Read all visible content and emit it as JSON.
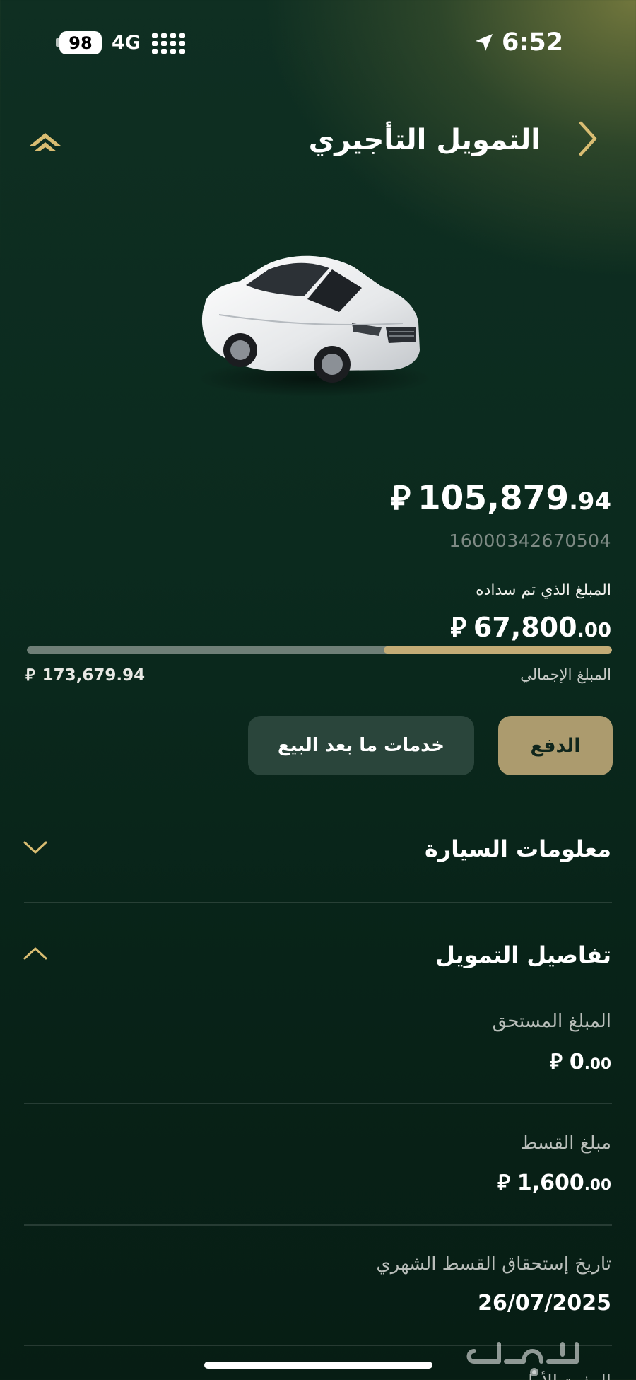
{
  "status_bar": {
    "battery": "98",
    "network": "4G",
    "time": "6:52"
  },
  "header": {
    "title": "التمويل التأجيري"
  },
  "summary": {
    "balance_int": "105,879",
    "balance_dec": ".94",
    "contract_number": "16000342670504",
    "paid_label": "المبلغ الذي تم سداده",
    "paid_int": "67,800",
    "paid_dec": ".00",
    "total_label": "المبلغ الإجمالي",
    "total_amount": "173,679.94",
    "paid_fraction": 0.39
  },
  "actions": {
    "pay_label": "الدفع",
    "aftersales_label": "خدمات ما بعد البيع"
  },
  "sections": {
    "car_info_title": "معلومات السيارة",
    "financing_title": "تفاصيل التمويل"
  },
  "financing": {
    "due_label": "المبلغ المستحق",
    "due_int": "0",
    "due_dec": ".00",
    "installment_label": "مبلغ القسط",
    "installment_int": "1,600",
    "installment_dec": ".00",
    "due_date_label": "تاريخ إستحقاق القسط الشهري",
    "due_date": "26/07/2025",
    "next_label_partial": "الدفعة الأولى"
  },
  "currency_symbol": "⃁",
  "icons": {
    "collapse": "double-chevron-up-icon",
    "back": "chevron-right-icon",
    "location": "location-arrow-icon",
    "currency": "riyal-symbol-icon"
  },
  "colors": {
    "accent_gold": "#c3ac76",
    "pay_button": "#ac9b6e",
    "secondary_button": "#2a453b",
    "progress_track": "#6f7f77"
  }
}
